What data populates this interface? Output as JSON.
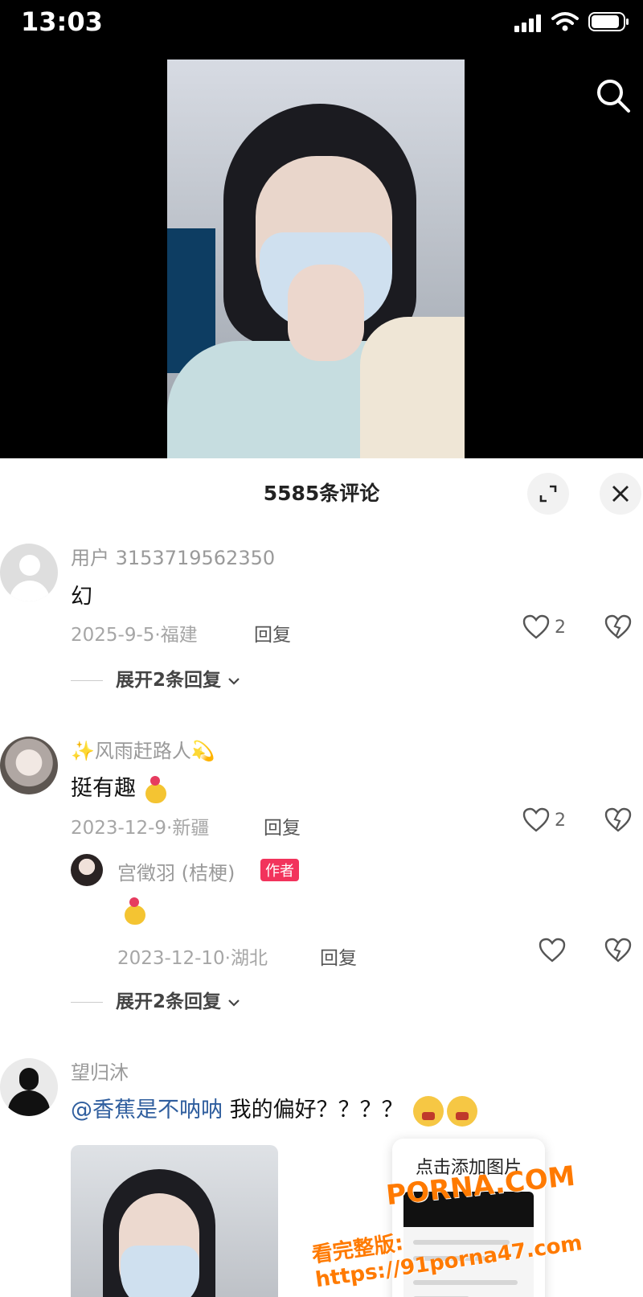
{
  "status_bar": {
    "time": "13:03"
  },
  "sheet": {
    "title": "5585条评论"
  },
  "comments": [
    {
      "username": "用户 3153719562350",
      "text": "幻",
      "date_location": "2025-9-5·福建",
      "reply_label": "回复",
      "likes": "2",
      "expand_label": "展开2条回复"
    },
    {
      "username": "✨风雨赶路人💫",
      "text": "挺有趣",
      "date_location": "2023-12-9·新疆",
      "reply_label": "回复",
      "likes": "2",
      "subreply": {
        "username": "宫徵羽 (桔梗)",
        "badge": "作者",
        "date_location": "2023-12-10·湖北",
        "reply_label": "回复"
      },
      "expand_label": "展开2条回复"
    },
    {
      "username": "望归沐",
      "mention": "@香蕉是不呐呐",
      "text": " 我的偏好？？？？",
      "add_image_label": "点击添加图片"
    }
  ],
  "watermark": {
    "line1": "PORNA.COM",
    "line2": "看完整版: https://91porna47.com"
  },
  "colors": {
    "author_badge": "#f2335c",
    "mention": "#2f5e9e",
    "watermark": "#ff7a00"
  }
}
